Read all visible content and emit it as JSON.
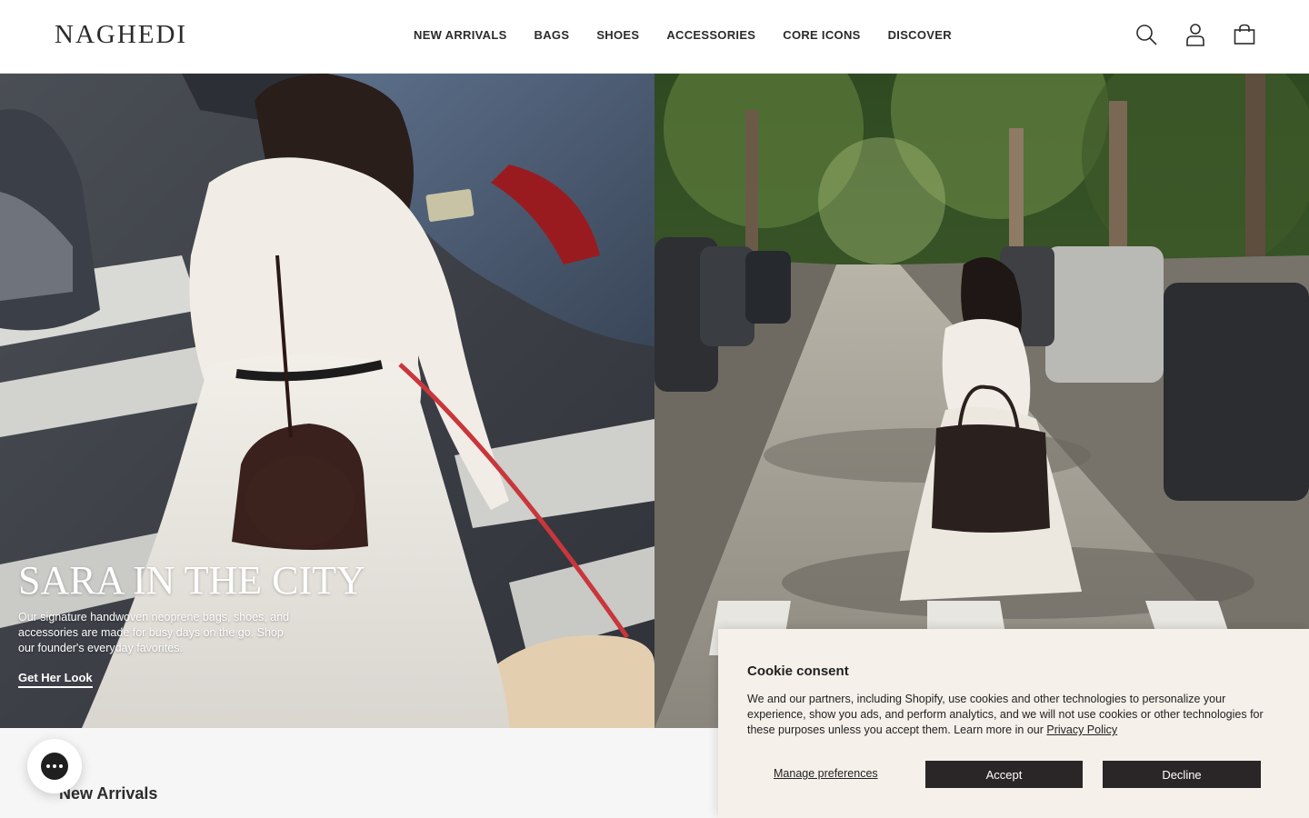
{
  "brand": {
    "logo_text": "NAGHEDI"
  },
  "nav": {
    "items": [
      {
        "label": "NEW ARRIVALS"
      },
      {
        "label": "BAGS"
      },
      {
        "label": "SHOES"
      },
      {
        "label": "ACCESSORIES"
      },
      {
        "label": "CORE ICONS"
      },
      {
        "label": "DISCOVER"
      }
    ]
  },
  "header_icons": [
    "search-icon",
    "account-icon",
    "cart-icon"
  ],
  "hero": {
    "title": "SARA IN THE CITY",
    "description": "Our signature handwoven neoprene bags, shoes, and accessories are made for busy days on the go. Shop our founder's everyday favorites.",
    "cta_label": "Get Her Look"
  },
  "section": {
    "title": "New Arrivals"
  },
  "cookie": {
    "title": "Cookie consent",
    "body": "We and our partners, including Shopify, use cookies and other technologies to personalize your experience, show you ads, and perform analytics, and we will not use cookies or other technologies for these purposes unless you accept them. Learn more in our ",
    "privacy_link": "Privacy Policy",
    "manage_label": "Manage preferences",
    "accept_label": "Accept",
    "decline_label": "Decline"
  },
  "colors": {
    "header_bg": "#ffffff",
    "dark_button": "#2a2526",
    "cookie_bg": "#f5f0ea",
    "page_bg": "#f6f6f6"
  }
}
